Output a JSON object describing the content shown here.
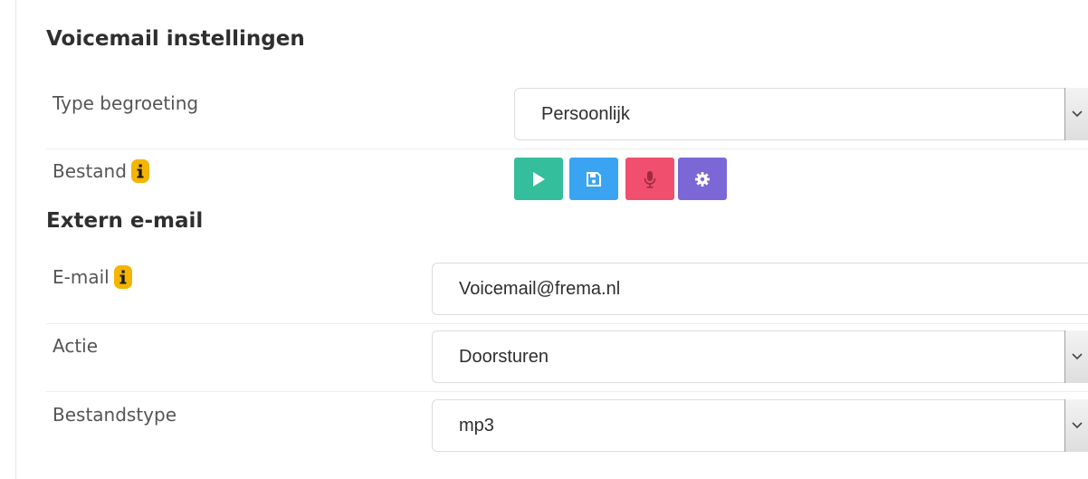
{
  "voicemail": {
    "title": "Voicemail instellingen",
    "greeting_type": {
      "label": "Type begroeting",
      "value": "Persoonlijk"
    },
    "file": {
      "label": "Bestand"
    },
    "buttons": {
      "play_color": "#34be9c",
      "save_color": "#3aa4f2",
      "record_color": "#f0506e",
      "settings_color": "#7b68d6"
    }
  },
  "external_email": {
    "title": "Extern e-mail",
    "email": {
      "label": "E-mail",
      "value": "Voicemail@frema.nl"
    },
    "action": {
      "label": "Actie",
      "value": "Doorsturen"
    },
    "filetype": {
      "label": "Bestandstype",
      "value": "mp3"
    }
  },
  "colors": {
    "info_badge": "#f4b400"
  }
}
